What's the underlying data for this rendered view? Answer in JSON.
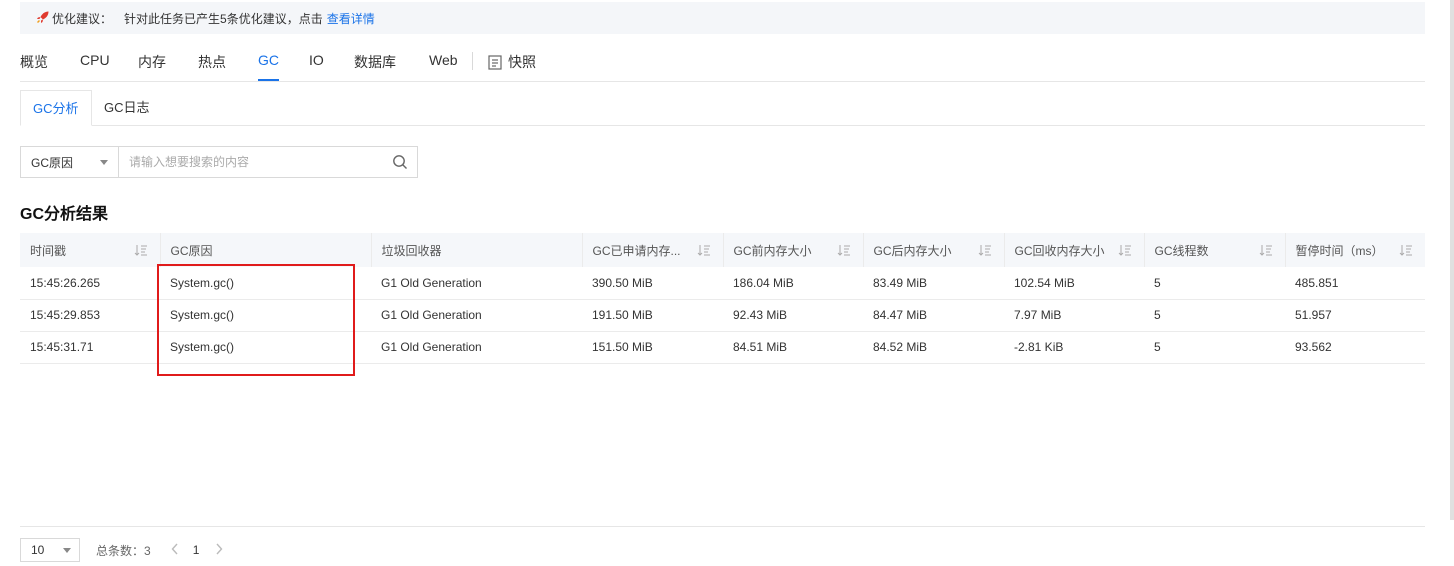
{
  "notice": {
    "icon": "rocket-icon",
    "label": "优化建议：",
    "text": "针对此任务已产生5条优化建议，点击",
    "link": "查看详情"
  },
  "tabs": [
    {
      "label": "概览"
    },
    {
      "label": "CPU"
    },
    {
      "label": "内存"
    },
    {
      "label": "热点"
    },
    {
      "label": "GC",
      "active": true
    },
    {
      "label": "IO"
    },
    {
      "label": "数据库"
    },
    {
      "label": "Web"
    }
  ],
  "snapshot_label": "快照",
  "subtabs": [
    {
      "label": "GC分析",
      "active": true
    },
    {
      "label": "GC日志"
    }
  ],
  "search": {
    "field_value": "GC原因",
    "placeholder": "请输入想要搜索的内容"
  },
  "section_title": "GC分析结果",
  "table": {
    "headers": [
      "时间戳",
      "GC原因",
      "垃圾回收器",
      "GC已申请内存...",
      "GC前内存大小",
      "GC后内存大小",
      "GC回收内存大小",
      "GC线程数",
      "暂停时间（ms）"
    ],
    "rows": [
      [
        "15:45:26.265",
        "System.gc()",
        "G1 Old Generation",
        "390.50 MiB",
        "186.04 MiB",
        "83.49 MiB",
        "102.54 MiB",
        "5",
        "485.851"
      ],
      [
        "15:45:29.853",
        "System.gc()",
        "G1 Old Generation",
        "191.50 MiB",
        "92.43 MiB",
        "84.47 MiB",
        "7.97 MiB",
        "5",
        "51.957"
      ],
      [
        "15:45:31.71",
        "System.gc()",
        "G1 Old Generation",
        "151.50 MiB",
        "84.51 MiB",
        "84.52 MiB",
        "-2.81 KiB",
        "5",
        "93.562"
      ]
    ]
  },
  "pager": {
    "page_size": "10",
    "total_label": "总条数：",
    "total": "3",
    "current_page": "1"
  },
  "colors": {
    "accent": "#1a73e8",
    "highlight": "#e01b1b"
  }
}
